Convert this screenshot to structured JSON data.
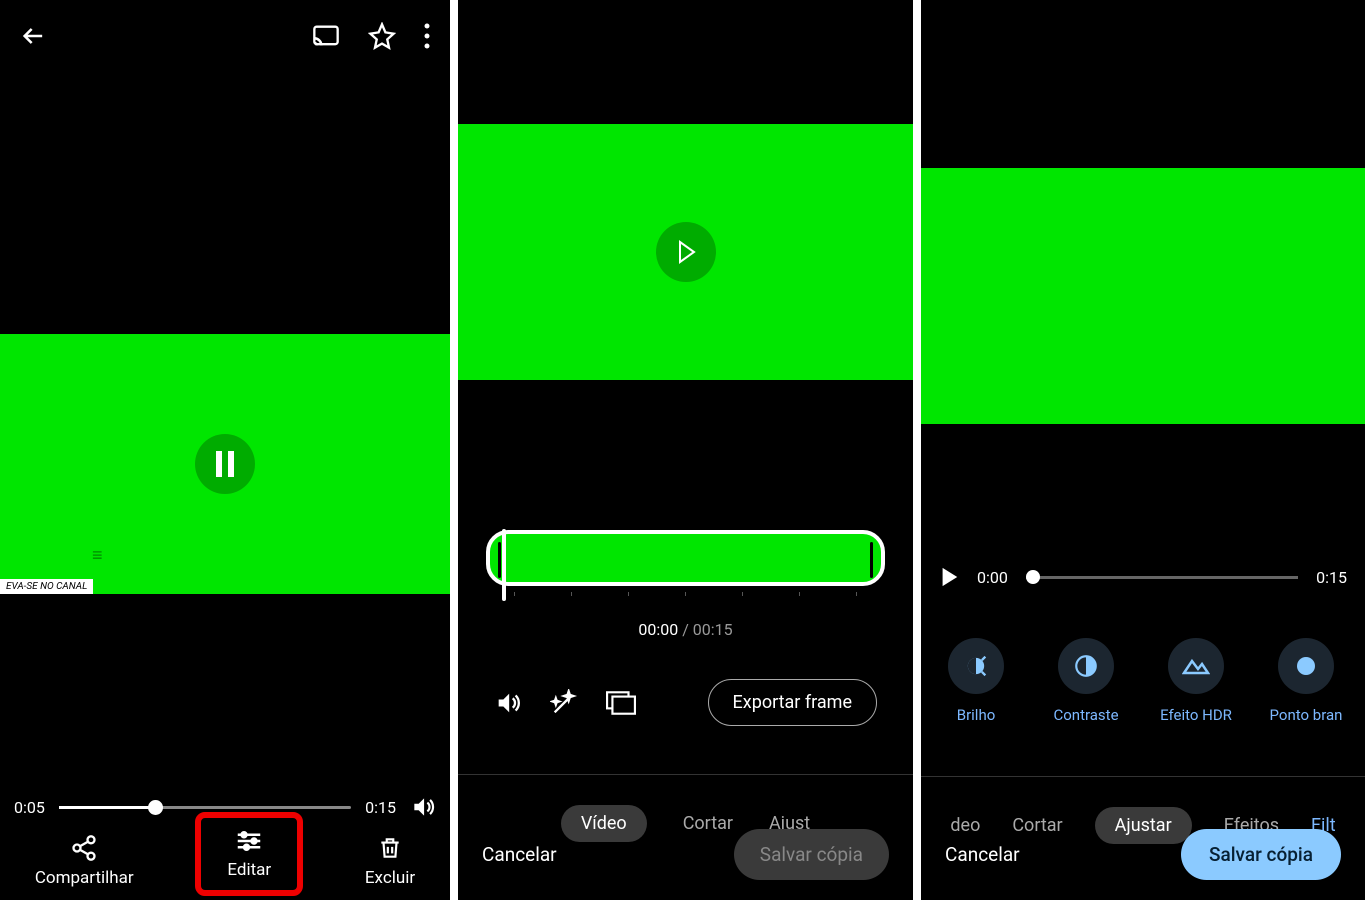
{
  "s1": {
    "caption": "EVA-SE NO CANAL",
    "current": "0:05",
    "duration": "0:15",
    "actions": {
      "share": "Compartilhar",
      "edit": "Editar",
      "delete": "Excluir"
    }
  },
  "s2": {
    "time_current": "00:00",
    "time_sep": " / ",
    "time_total": "00:15",
    "export": "Exportar frame",
    "tabs": {
      "video": "Vídeo",
      "crop": "Cortar",
      "adjust": "Ajust"
    },
    "cancel": "Cancelar",
    "save": "Salvar cópia"
  },
  "s3": {
    "current": "0:00",
    "duration": "0:15",
    "adjust": {
      "brightness": "Brilho",
      "contrast": "Contraste",
      "hdr": "Efeito HDR",
      "wp": "Ponto bran"
    },
    "tabs": {
      "video": "deo",
      "crop": "Cortar",
      "adjust": "Ajustar",
      "effects": "Efeitos",
      "filters": "Filt"
    },
    "cancel": "Cancelar",
    "save": "Salvar cópia"
  }
}
